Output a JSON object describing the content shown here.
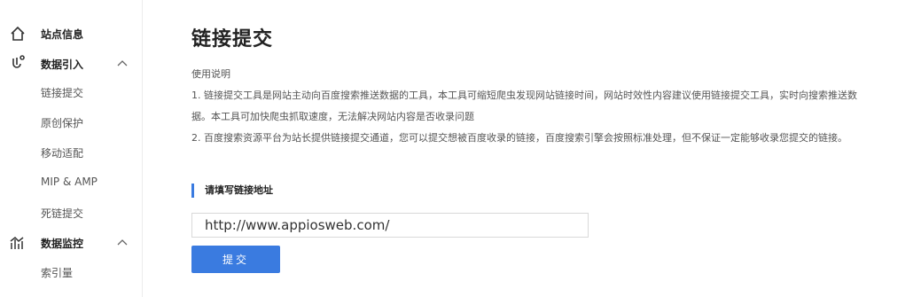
{
  "sidebar": {
    "site_info": "站点信息",
    "data_import": {
      "title": "数据引入",
      "items": [
        "链接提交",
        "原创保护",
        "移动适配",
        "MIP & AMP",
        "死链提交"
      ]
    },
    "data_monitor": {
      "title": "数据监控",
      "items": [
        "索引量"
      ]
    }
  },
  "main": {
    "title": "链接提交",
    "usage_heading": "使用说明",
    "instructions": [
      "1. 链接提交工具是网站主动向百度搜索推送数据的工具，本工具可缩短爬虫发现网站链接时间，网站时效性内容建议使用链接提交工具，实时向搜索推送数",
      "据。本工具可加快爬虫抓取速度，无法解决网站内容是否收录问题",
      "2. 百度搜索资源平台为站长提供链接提交通道，您可以提交想被百度收录的链接，百度搜索引擎会按照标准处理，但不保证一定能够收录您提交的链接。"
    ],
    "section_label": "请填写链接地址",
    "url_input_value": "http://www.appiosweb.com/",
    "submit_label": "提交"
  },
  "colors": {
    "accent": "#3a7be0"
  }
}
